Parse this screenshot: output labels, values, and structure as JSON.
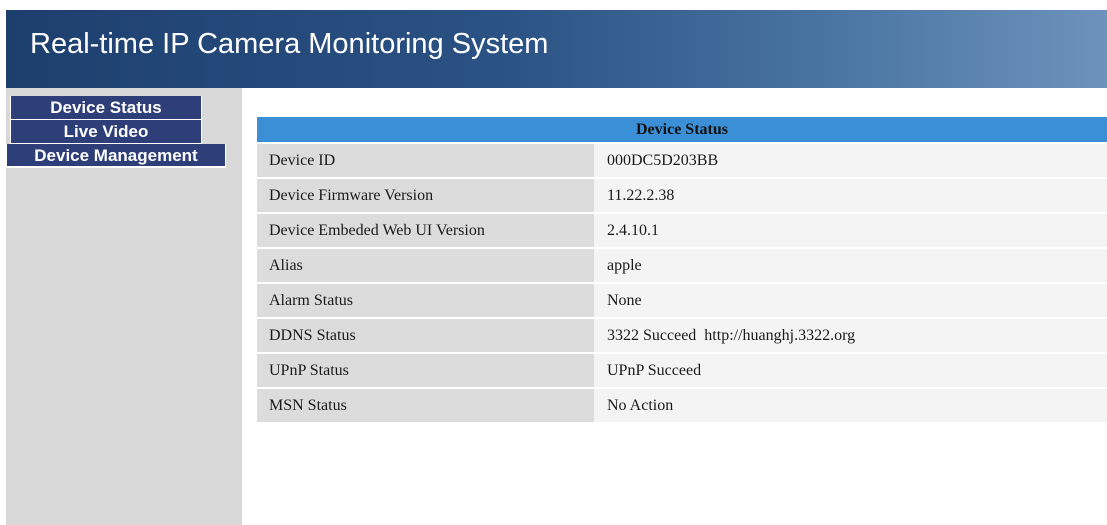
{
  "header": {
    "title": "Real-time IP Camera Monitoring System"
  },
  "sidebar": {
    "items": [
      {
        "label": "Device Status"
      },
      {
        "label": "Live Video"
      },
      {
        "label": "Device Management"
      }
    ]
  },
  "status_table": {
    "title": "Device Status",
    "rows": [
      {
        "label": "Device ID",
        "value": "000DC5D203BB"
      },
      {
        "label": "Device Firmware Version",
        "value": "11.22.2.38"
      },
      {
        "label": "Device Embeded Web UI Version",
        "value": "2.4.10.1"
      },
      {
        "label": "Alias",
        "value": "apple"
      },
      {
        "label": "Alarm Status",
        "value": "None"
      },
      {
        "label": "DDNS Status",
        "value": "3322 Succeed  http://huanghj.3322.org"
      },
      {
        "label": "UPnP Status",
        "value": "UPnP Succeed"
      },
      {
        "label": "MSN Status",
        "value": "No Action"
      }
    ]
  },
  "colors": {
    "header_dark": "#1d3f6e",
    "header_light": "#6c93bb",
    "nav_bg": "#2e3e78",
    "table_header": "#3b8fd6",
    "sidebar_bg": "#d8d8d8"
  }
}
